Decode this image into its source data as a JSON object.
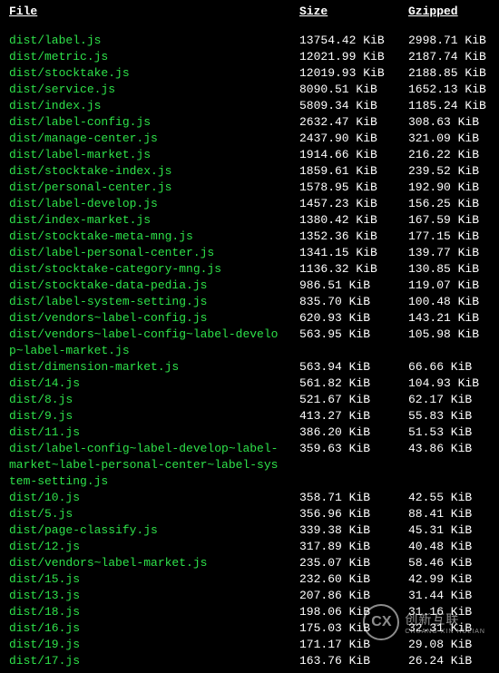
{
  "header": {
    "file": "File",
    "size": "Size",
    "gzipped": "Gzipped"
  },
  "rows": [
    {
      "file": "dist/label.js",
      "size": "13754.42 KiB",
      "gzipped": "2998.71 KiB"
    },
    {
      "file": "dist/metric.js",
      "size": "12021.99 KiB",
      "gzipped": "2187.74 KiB"
    },
    {
      "file": "dist/stocktake.js",
      "size": "12019.93 KiB",
      "gzipped": "2188.85 KiB"
    },
    {
      "file": "dist/service.js",
      "size": "8090.51 KiB",
      "gzipped": "1652.13 KiB"
    },
    {
      "file": "dist/index.js",
      "size": "5809.34 KiB",
      "gzipped": "1185.24 KiB"
    },
    {
      "file": "dist/label-config.js",
      "size": "2632.47 KiB",
      "gzipped": "308.63 KiB"
    },
    {
      "file": "dist/manage-center.js",
      "size": "2437.90 KiB",
      "gzipped": "321.09 KiB"
    },
    {
      "file": "dist/label-market.js",
      "size": "1914.66 KiB",
      "gzipped": "216.22 KiB"
    },
    {
      "file": "dist/stocktake-index.js",
      "size": "1859.61 KiB",
      "gzipped": "239.52 KiB"
    },
    {
      "file": "dist/personal-center.js",
      "size": "1578.95 KiB",
      "gzipped": "192.90 KiB"
    },
    {
      "file": "dist/label-develop.js",
      "size": "1457.23 KiB",
      "gzipped": "156.25 KiB"
    },
    {
      "file": "dist/index-market.js",
      "size": "1380.42 KiB",
      "gzipped": "167.59 KiB"
    },
    {
      "file": "dist/stocktake-meta-mng.js",
      "size": "1352.36 KiB",
      "gzipped": "177.15 KiB"
    },
    {
      "file": "dist/label-personal-center.js",
      "size": "1341.15 KiB",
      "gzipped": "139.77 KiB"
    },
    {
      "file": "dist/stocktake-category-mng.js",
      "size": "1136.32 KiB",
      "gzipped": "130.85 KiB"
    },
    {
      "file": "dist/stocktake-data-pedia.js",
      "size": "986.51 KiB",
      "gzipped": "119.07 KiB"
    },
    {
      "file": "dist/label-system-setting.js",
      "size": "835.70 KiB",
      "gzipped": "100.48 KiB"
    },
    {
      "file": "dist/vendors~label-config.js",
      "size": "620.93 KiB",
      "gzipped": "143.21 KiB"
    }
  ],
  "wrap1": {
    "line1": "dist/vendors~label-config~label-develo",
    "line2": "p~label-market.js",
    "size": "563.95 KiB",
    "gzipped": "105.98 KiB"
  },
  "rows2": [
    {
      "file": "dist/dimension-market.js",
      "size": "563.94 KiB",
      "gzipped": "66.66 KiB"
    },
    {
      "file": "dist/14.js",
      "size": "561.82 KiB",
      "gzipped": "104.93 KiB"
    },
    {
      "file": "dist/8.js",
      "size": "521.67 KiB",
      "gzipped": "62.17 KiB"
    },
    {
      "file": "dist/9.js",
      "size": "413.27 KiB",
      "gzipped": "55.83 KiB"
    },
    {
      "file": "dist/11.js",
      "size": "386.20 KiB",
      "gzipped": "51.53 KiB"
    }
  ],
  "wrap2": {
    "line1": "dist/label-config~label-develop~label-",
    "line2": "market~label-personal-center~label-sys",
    "line3": "tem-setting.js",
    "size": "359.63 KiB",
    "gzipped": "43.86 KiB"
  },
  "rows3": [
    {
      "file": "dist/10.js",
      "size": "358.71 KiB",
      "gzipped": "42.55 KiB"
    },
    {
      "file": "dist/5.js",
      "size": "356.96 KiB",
      "gzipped": "88.41 KiB"
    },
    {
      "file": "dist/page-classify.js",
      "size": "339.38 KiB",
      "gzipped": "45.31 KiB"
    },
    {
      "file": "dist/12.js",
      "size": "317.89 KiB",
      "gzipped": "40.48 KiB"
    },
    {
      "file": "dist/vendors~label-market.js",
      "size": "235.07 KiB",
      "gzipped": "58.46 KiB"
    },
    {
      "file": "dist/15.js",
      "size": "232.60 KiB",
      "gzipped": "42.99 KiB"
    },
    {
      "file": "dist/13.js",
      "size": "207.86 KiB",
      "gzipped": "31.44 KiB"
    },
    {
      "file": "dist/18.js",
      "size": "198.06 KiB",
      "gzipped": "31.16 KiB"
    },
    {
      "file": "dist/16.js",
      "size": "175.03 KiB",
      "gzipped": "32.31 KiB"
    },
    {
      "file": "dist/19.js",
      "size": "171.17 KiB",
      "gzipped": "29.08 KiB"
    },
    {
      "file": "dist/17.js",
      "size": "163.76 KiB",
      "gzipped": "26.24 KiB"
    }
  ],
  "watermark": {
    "logo": "CX",
    "text": "创新互联",
    "sub": "CHUANG XIN HULIAN"
  }
}
